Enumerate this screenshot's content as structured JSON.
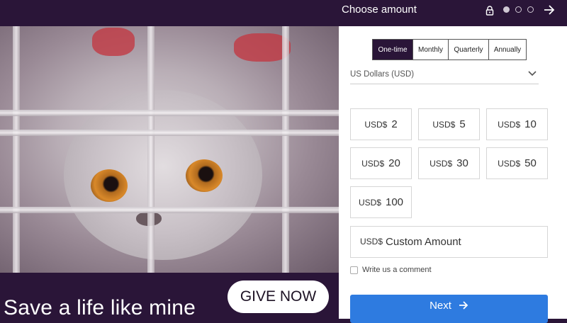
{
  "hero": {
    "tagline": "Save a life like mine",
    "cta_label": "GIVE NOW",
    "image_subject": "cat-behind-cage-bars"
  },
  "header": {
    "title": "Choose amount",
    "steps_total": 3,
    "step_current": 1
  },
  "frequency": {
    "options": [
      "One-time",
      "Monthly",
      "Quarterly",
      "Annually"
    ],
    "selected": "One-time"
  },
  "currency": {
    "selected": "US Dollars (USD)"
  },
  "amounts": {
    "currency_prefix": "USD$",
    "values": [
      "2",
      "5",
      "10",
      "20",
      "30",
      "50",
      "100"
    ]
  },
  "custom_amount": {
    "prefix": "USD$",
    "placeholder": "Custom Amount"
  },
  "comment": {
    "label": "Write us a comment",
    "checked": false
  },
  "next_button": {
    "label": "Next"
  },
  "colors": {
    "brand_dark": "#2a1538",
    "primary_button": "#2e7be0"
  },
  "icons": [
    "lock-icon",
    "arrow-right-icon",
    "chevron-down-icon"
  ]
}
